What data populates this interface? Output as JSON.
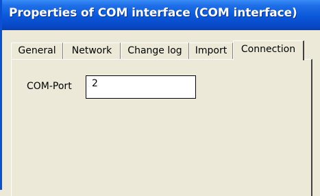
{
  "window": {
    "title": "Properties of COM interface (COM interface)"
  },
  "tabs": [
    {
      "label": "General"
    },
    {
      "label": "Network"
    },
    {
      "label": "Change log"
    },
    {
      "label": "Import"
    },
    {
      "label": "Connection"
    }
  ],
  "active_tab": "Connection",
  "connection": {
    "com_port_label": "COM-Port",
    "com_port_value": "2"
  }
}
